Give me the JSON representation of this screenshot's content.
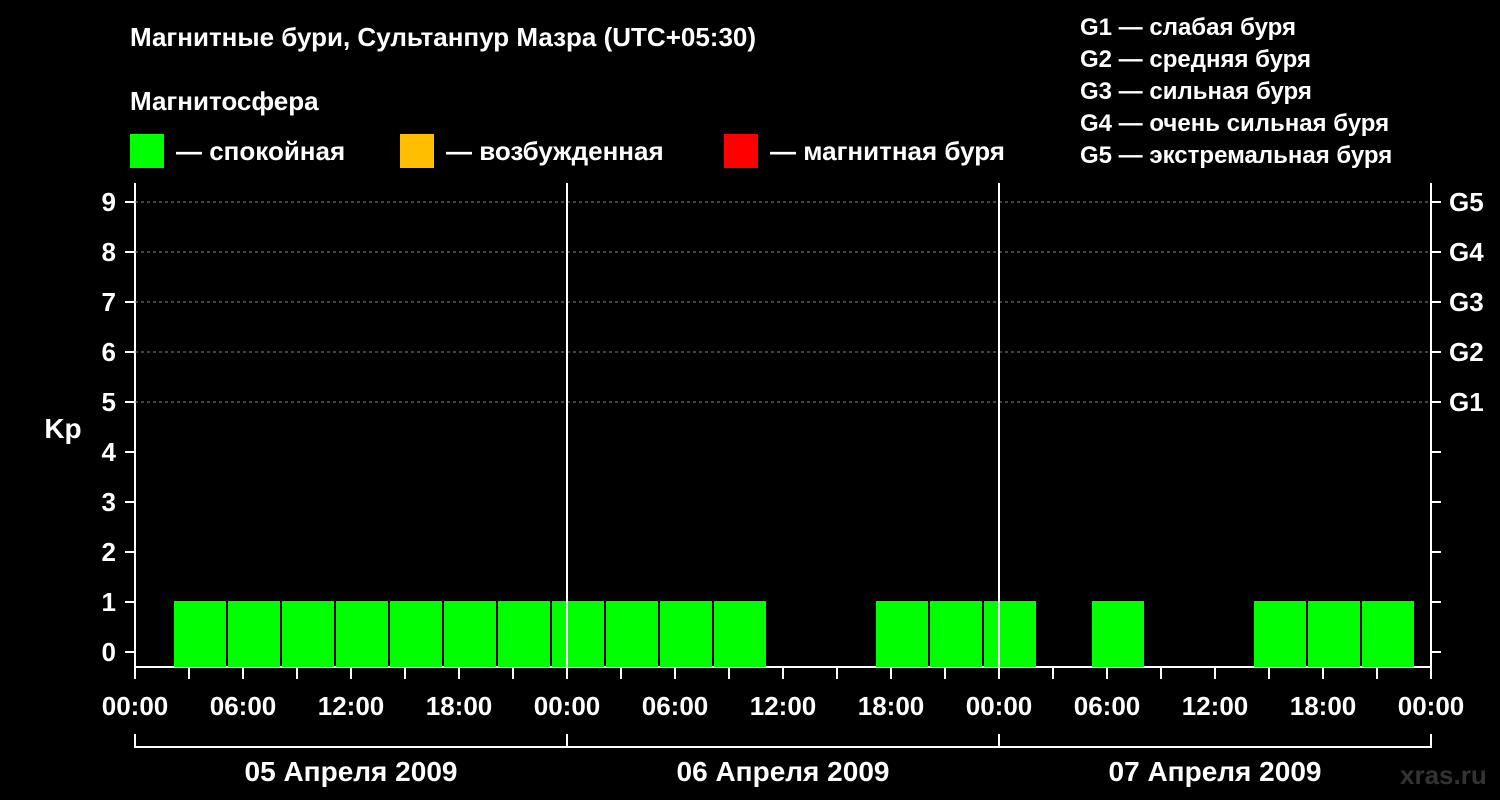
{
  "header": {
    "title": "Магнитные бури, Сультанпур Мазра (UTC+05:30)",
    "section_label": "Магнитосфера"
  },
  "legend": [
    {
      "label": "— спокойная",
      "color": "#00ff00"
    },
    {
      "label": "— возбужденная",
      "color": "#ffbf00"
    },
    {
      "label": "— магнитная буря",
      "color": "#ff0000"
    }
  ],
  "g_scale_legend": [
    "G1 — слабая буря",
    "G2 — средняя буря",
    "G3 — сильная буря",
    "G4 — очень сильная буря",
    "G5 — экстремальная буря"
  ],
  "watermark": "xras.ru",
  "chart_data": {
    "type": "bar",
    "ylabel": "Kp",
    "ylim": [
      0,
      9
    ],
    "yticks": [
      "0",
      "1",
      "2",
      "3",
      "4",
      "5",
      "6",
      "7",
      "8",
      "9"
    ],
    "right_axis_ticks": [
      {
        "kp": 5,
        "label": "G1"
      },
      {
        "kp": 6,
        "label": "G2"
      },
      {
        "kp": 7,
        "label": "G3"
      },
      {
        "kp": 8,
        "label": "G4"
      },
      {
        "kp": 9,
        "label": "G5"
      }
    ],
    "xticks": [
      "00:00",
      "06:00",
      "12:00",
      "18:00",
      "00:00",
      "06:00",
      "12:00",
      "18:00",
      "00:00",
      "06:00",
      "12:00",
      "18:00",
      "00:00"
    ],
    "days": [
      "05 Апреля 2009",
      "06 Апреля 2009",
      "07 Апреля 2009"
    ],
    "interval_hours": 3,
    "grid": "dashed at 5-9",
    "bars": [
      {
        "day": "05 Апреля 2009",
        "values": [
          1,
          1,
          1,
          1,
          1,
          1,
          1,
          1
        ]
      },
      {
        "day": "06 Апреля 2009",
        "values": [
          1,
          1,
          1,
          0,
          0,
          1,
          1,
          1
        ]
      },
      {
        "day": "07 Апреля 2009",
        "values": [
          0,
          1,
          0,
          0,
          1,
          1,
          1,
          0
        ]
      }
    ],
    "bar_color": "#00ff00"
  }
}
